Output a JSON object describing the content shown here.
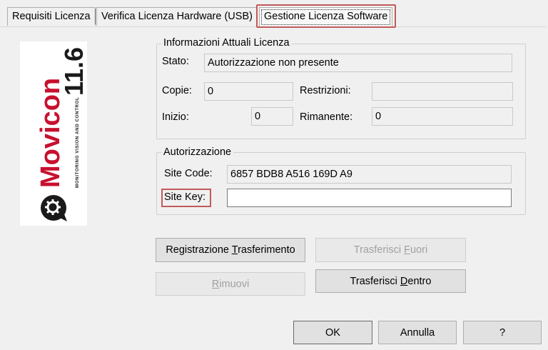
{
  "tabs": [
    {
      "label": "Requisiti Licenza",
      "active": false
    },
    {
      "label": "Verifica Licenza Hardware (USB)",
      "active": false
    },
    {
      "label": "Gestione Licenza Software",
      "active": true
    }
  ],
  "logo": {
    "brand": "Movicon",
    "version": "11.6",
    "tagline": "MONITORING VISION AND CONTROL",
    "brand_color": "#c8102e"
  },
  "current_license": {
    "legend": "Informazioni Attuali Licenza",
    "status_label": "Stato:",
    "status_value": "Autorizzazione non presente",
    "copies_label": "Copie:",
    "copies_value": "0",
    "restrictions_label": "Restrizioni:",
    "restrictions_value": "",
    "start_label": "Inizio:",
    "start_value": "0",
    "remaining_label": "Rimanente:",
    "remaining_value": "0"
  },
  "authorization": {
    "legend": "Autorizzazione",
    "site_code_label": "Site Code:",
    "site_code_value": "6857 BDB8 A516 169D A9",
    "site_key_label": "Site Key:",
    "site_key_value": ""
  },
  "actions": {
    "register_transfer": {
      "pre": "Registrazione ",
      "u": "T",
      "post": "rasferimento"
    },
    "transfer_out": {
      "pre": "Trasferisci ",
      "u": "F",
      "post": "uori"
    },
    "remove": {
      "pre": "",
      "u": "R",
      "post": "imuovi"
    },
    "transfer_in": {
      "pre": "Trasferisci ",
      "u": "D",
      "post": "entro"
    }
  },
  "dialog": {
    "ok_label": "OK",
    "cancel_label": "Annulla",
    "help_label": "?"
  },
  "colors": {
    "highlight": "#c25a5a",
    "window_bg": "#f0f0f0"
  }
}
